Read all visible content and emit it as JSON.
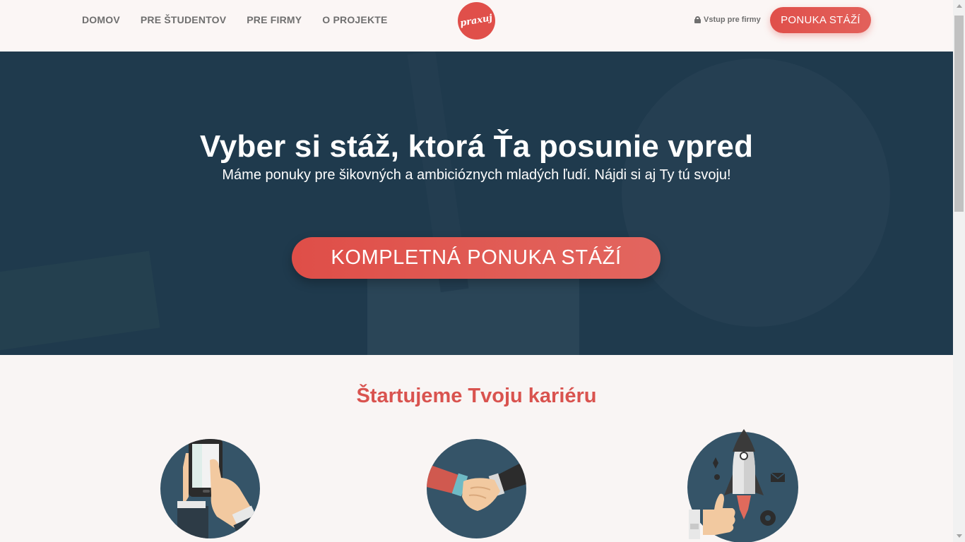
{
  "nav": {
    "items": [
      "DOMOV",
      "PRE ŠTUDENTOV",
      "PRE FIRMY",
      "O PROJEKTE"
    ],
    "logo_text": "praxuj",
    "login_label": "Vstup pre firmy",
    "cta_label": "PONUKA STÁŽÍ"
  },
  "hero": {
    "title": "Vyber si stáž, ktorá Ťa posunie vpred",
    "subtitle": "Máme ponuky pre šikovných a ambicióznych mladých ľudí. Nájdi si aj Ty tú svoju!",
    "button_label": "KOMPLETNÁ PONUKA STÁŽÍ"
  },
  "section": {
    "title": "Štartujeme Tvoju kariéru"
  },
  "colors": {
    "accent": "#e04f4a",
    "hero_bg": "#1f3a4d",
    "circle_bg": "#355468"
  }
}
